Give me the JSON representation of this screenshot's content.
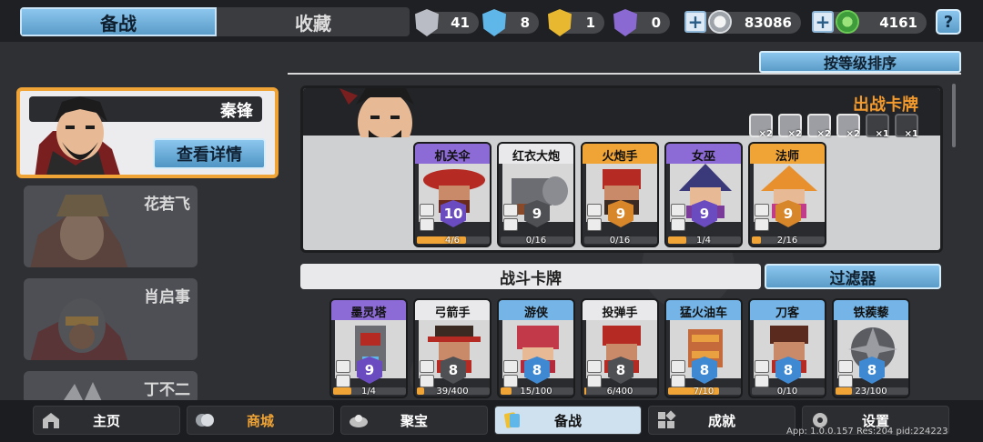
{
  "top_tabs": [
    {
      "label": "备战",
      "active": true
    },
    {
      "label": "收藏",
      "active": false
    }
  ],
  "resources": [
    {
      "icon": "silver-shield-icon",
      "value": "41",
      "color": "#b9bcc4"
    },
    {
      "icon": "blue-crystal-shield-icon",
      "value": "8",
      "color": "#5fb6e8"
    },
    {
      "icon": "gold-shield-icon",
      "value": "1",
      "color": "#e8b830"
    },
    {
      "icon": "purple-shield-icon",
      "value": "0",
      "color": "#8a6ad2"
    }
  ],
  "currency": [
    {
      "icon": "silver-coin-icon",
      "value": "83086"
    },
    {
      "icon": "green-gem-icon",
      "value": "4161"
    }
  ],
  "help_label": "?",
  "heroes": [
    {
      "name": "秦锋",
      "selected": true
    },
    {
      "name": "花若飞",
      "selected": false
    },
    {
      "name": "肖启事",
      "selected": false
    },
    {
      "name": "丁不二",
      "selected": false
    }
  ],
  "detail_button": "查看详情",
  "sort_button": "按等级排序",
  "deck": {
    "title": "出战卡牌",
    "slots": [
      {
        "icon": "swords-slot-icon",
        "count": "×2"
      },
      {
        "icon": "soldier-slot-icon",
        "count": "×2"
      },
      {
        "icon": "helmet-slot-icon",
        "count": "×2"
      },
      {
        "icon": "skull-slot-icon",
        "count": "×2"
      },
      {
        "icon": "wall-slot-icon",
        "count": "×1"
      },
      {
        "icon": "gear-slot-icon",
        "count": "×1"
      }
    ],
    "cards": [
      {
        "name": "机关伞",
        "level": "10",
        "progress": "4/6",
        "fill": 0.67,
        "rarity": "purple"
      },
      {
        "name": "红衣大炮",
        "level": "9",
        "progress": "0/16",
        "fill": 0.0,
        "rarity": "white"
      },
      {
        "name": "火炮手",
        "level": "9",
        "progress": "0/16",
        "fill": 0.0,
        "rarity": "orange"
      },
      {
        "name": "女巫",
        "level": "9",
        "progress": "1/4",
        "fill": 0.25,
        "rarity": "purple"
      },
      {
        "name": "法师",
        "level": "9",
        "progress": "2/16",
        "fill": 0.125,
        "rarity": "orange"
      }
    ]
  },
  "battle_bar": "战斗卡牌",
  "filter_button": "过滤器",
  "battle_cards": [
    {
      "name": "墨灵塔",
      "level": "9",
      "progress": "1/4",
      "fill": 0.25,
      "rarity": "purple"
    },
    {
      "name": "弓箭手",
      "level": "8",
      "progress": "39/400",
      "fill": 0.1,
      "rarity": "white"
    },
    {
      "name": "游侠",
      "level": "8",
      "progress": "15/100",
      "fill": 0.15,
      "rarity": "blue"
    },
    {
      "name": "投弹手",
      "level": "8",
      "progress": "6/400",
      "fill": 0.02,
      "rarity": "white"
    },
    {
      "name": "猛火油车",
      "level": "8",
      "progress": "7/10",
      "fill": 0.7,
      "rarity": "blue"
    },
    {
      "name": "刀客",
      "level": "8",
      "progress": "0/10",
      "fill": 0.0,
      "rarity": "blue"
    },
    {
      "name": "铁蒺藜",
      "level": "8",
      "progress": "23/100",
      "fill": 0.23,
      "rarity": "blue"
    }
  ],
  "nav": [
    {
      "label": "主页",
      "icon": "house-icon"
    },
    {
      "label": "商城",
      "icon": "coins-icon"
    },
    {
      "label": "聚宝",
      "icon": "treasure-bowl-icon"
    },
    {
      "label": "备战",
      "icon": "card-deck-icon"
    },
    {
      "label": "成就",
      "icon": "achievements-icon"
    },
    {
      "label": "设置",
      "icon": "gear-icon"
    }
  ],
  "app_info": "App: 1.0.0.157 Res:204 pid:224223"
}
